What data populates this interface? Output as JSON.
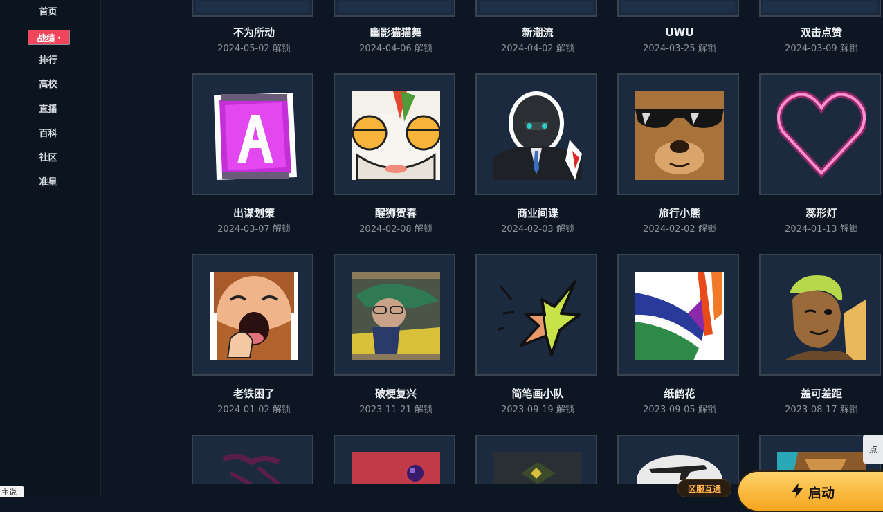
{
  "sidebar": {
    "items": [
      {
        "label": "首页"
      },
      {
        "label": "排行"
      },
      {
        "label": "高校"
      },
      {
        "label": "直播"
      },
      {
        "label": "百科"
      },
      {
        "label": "社区"
      },
      {
        "label": "准星"
      }
    ],
    "active": {
      "label": "战绩",
      "caret": "▾"
    },
    "corner_label": "主说"
  },
  "rows": [
    [
      {
        "title": "不为所动",
        "date": "2024-05-02 解锁"
      },
      {
        "title": "幽影猫猫舞",
        "date": "2024-04-06 解锁"
      },
      {
        "title": "新潮流",
        "date": "2024-04-02 解锁"
      },
      {
        "title": "UWU",
        "date": "2024-03-25 解锁"
      },
      {
        "title": "双击点赞",
        "date": "2024-03-09 解锁"
      }
    ],
    [
      {
        "title": "出谋划策",
        "date": "2024-03-07 解锁",
        "icon": "purple-card-icon"
      },
      {
        "title": "醒狮贺春",
        "date": "2024-02-08 解锁",
        "icon": "lion-dance-icon"
      },
      {
        "title": "商业间谍",
        "date": "2024-02-03 解锁",
        "icon": "spy-agent-icon"
      },
      {
        "title": "旅行小熊",
        "date": "2024-02-02 解锁",
        "icon": "bear-sunglasses-icon"
      },
      {
        "title": "蕊形灯",
        "date": "2024-01-13 解锁",
        "icon": "neon-heart-icon"
      }
    ],
    [
      {
        "title": "老铁困了",
        "date": "2024-01-02 解锁",
        "icon": "yawning-man-icon"
      },
      {
        "title": "破梗复兴",
        "date": "2023-11-21 解锁",
        "icon": "car-girl-icon"
      },
      {
        "title": "简笔画小队",
        "date": "2023-09-19 解锁",
        "icon": "sketch-bird-icon"
      },
      {
        "title": "纸鹤花",
        "date": "2023-09-05 解锁",
        "icon": "bird-of-paradise-icon"
      },
      {
        "title": "盖可差距",
        "date": "2023-08-17 解锁",
        "icon": "gekko-wink-icon"
      }
    ]
  ],
  "side_pill": "点",
  "region_button": "区服互通",
  "launch_button": "启动"
}
